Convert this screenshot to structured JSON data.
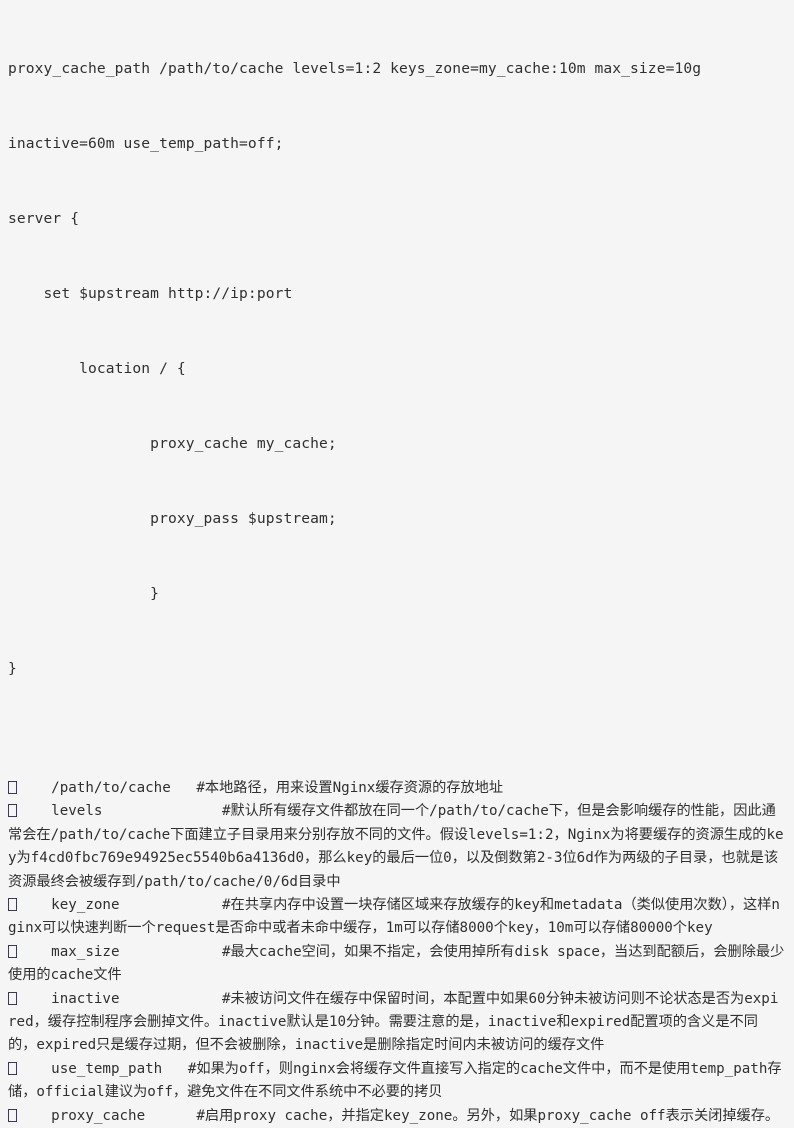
{
  "document": {
    "background_color": "#f5f5f5",
    "text_color": "#303030",
    "bullet_glyph": "missing-glyph-box"
  },
  "code_block": {
    "language": "nginx",
    "lines": [
      "proxy_cache_path /path/to/cache levels=1:2 keys_zone=my_cache:10m max_size=10g",
      "inactive=60m use_temp_path=off;",
      "server {",
      "    set $upstream http://ip:port",
      "        location / {",
      "                proxy_cache my_cache;",
      "                proxy_pass $upstream;",
      "                }",
      "}"
    ]
  },
  "notes": {
    "items": [
      {
        "term": "/path/to/cache",
        "head_spacing": "    /path/to/cache   ",
        "comment": "#本地路径，用来设置Nginx缓存资源的存放地址"
      },
      {
        "term": "levels",
        "head_spacing": "    levels              ",
        "comment": "#默认所有缓存文件都放在同一个/path/to/cache下，但是会影响缓存的性能，因此通常会在/path/to/cache下面建立子目录用来分别存放不同的文件。假设levels=1:2，Nginx为将要缓存的资源生成的key为f4cd0fbc769e94925ec5540b6a4136d0，那么key的最后一位0，以及倒数第2-3位6d作为两级的子目录，也就是该资源最终会被缓存到/path/to/cache/0/6d目录中"
      },
      {
        "term": "key_zone",
        "head_spacing": "    key_zone            ",
        "comment": "#在共享内存中设置一块存储区域来存放缓存的key和metadata（类似使用次数），这样nginx可以快速判断一个request是否命中或者未命中缓存，1m可以存储8000个key，10m可以存储80000个key"
      },
      {
        "term": "max_size",
        "head_spacing": "    max_size            ",
        "comment": "#最大cache空间，如果不指定，会使用掉所有disk space，当达到配额后，会删除最少使用的cache文件"
      },
      {
        "term": "inactive",
        "head_spacing": "    inactive            ",
        "comment": "#未被访问文件在缓存中保留时间，本配置中如果60分钟未被访问则不论状态是否为expired，缓存控制程序会删掉文件。inactive默认是10分钟。需要注意的是，inactive和expired配置项的含义是不同的，expired只是缓存过期，但不会被删除，inactive是删除指定时间内未被访问的缓存文件"
      },
      {
        "term": "use_temp_path",
        "head_spacing": "    use_temp_path   ",
        "comment": "#如果为off，则nginx会将缓存文件直接写入指定的cache文件中，而不是使用temp_path存储，official建议为off，避免文件在不同文件系统中不必要的拷贝"
      },
      {
        "term": "proxy_cache",
        "head_spacing": "    proxy_cache      ",
        "comment": "#启用proxy cache，并指定key_zone。另外，如果proxy_cache off表示关闭掉缓存。"
      }
    ]
  }
}
